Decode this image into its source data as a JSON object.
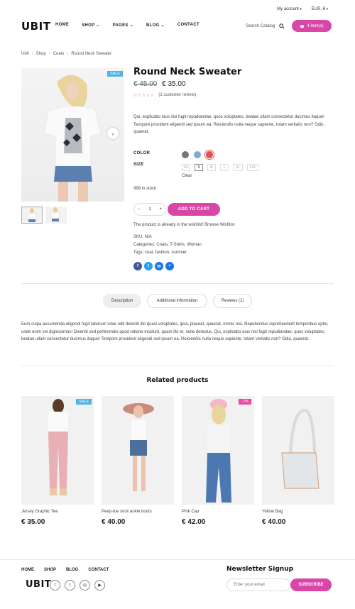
{
  "topbar": {
    "account": "My account",
    "currency": "EUR, €"
  },
  "logo": "UBIT",
  "nav": [
    "HOME",
    "SHOP",
    "PAGES",
    "BLOG",
    "CONTACT"
  ],
  "search": {
    "placeholder": "Search Catalog"
  },
  "cart": {
    "label": "4 item(s)"
  },
  "breadcrumb": [
    "Ubit",
    "Shop",
    "Coats",
    "Round Neck Sweater"
  ],
  "product": {
    "badge": "SALE",
    "title": "Round Neck Sweater",
    "old_price": "€ 45.00",
    "price": "€ 35.00",
    "stars": "☆☆☆☆☆",
    "review": "(1 customer review)",
    "description": "Qui, explicabo eius nisi fugit repudiandae, quos voluptates, beatae ullam consectetur ducimus itaque! Tempore provident eligendi sed ipsum ea. Reiciendis nulla neque sapiente, totam veritatis non? Odio, quaerat.",
    "color_label": "COLOR",
    "colors": [
      "#777777",
      "#7fa9d6",
      "#e35050"
    ],
    "size_label": "SIZE",
    "sizes": [
      "XS",
      "S",
      "M",
      "L",
      "XL",
      "XXL"
    ],
    "selected_size": "S",
    "clear": "Clear",
    "stock": "999 in stock",
    "qty": "1",
    "add_to_cart": "ADD TO CART",
    "wishlist": "The product is already in the wishlist! Browse Wishlist",
    "sku": "SKU: N/A",
    "categories": "Categories: Coats, T-Shirts, Woman",
    "tags": "Tags: coat, fashion, summer",
    "share_colors": [
      "#3b5998",
      "#1da1f2",
      "#1a73e8",
      "#1a73e8"
    ]
  },
  "tabs": [
    "Description",
    "Additional information",
    "Reviews (1)"
  ],
  "long_description": "Eum culpa assumenda eligendi fugit laborum vitae odit deleniti illo quasi voluptates, ipsa, placeat, quaerat, omnis nisi. Repellendus reprehenderit temporibus optio, unde enim vel dignissimos! Deleniti sed perferendis quod ratione incidunt, quam illo et, nulla delectus. Qui, explicabo eius nisi fugit repudiandae, quos voluptates, beatae ullam consectetur ducimus itaque! Tempore provident eligendi sed ipsum ea. Reiciendis nulla neque sapiente, totam veritatis non? Odio, quaerat.",
  "related": {
    "title": "Related products",
    "items": [
      {
        "name": "Jersey Graphic Tee",
        "price": "€ 35.00",
        "badge": "SALE"
      },
      {
        "name": "Peep-toe sock ankle boots",
        "price": "€ 40.00",
        "badge": ""
      },
      {
        "name": "Pink Cap",
        "price": "€ 42.00",
        "badge": "-7%"
      },
      {
        "name": "Yellow Bag",
        "price": "€ 40.00",
        "badge": ""
      }
    ]
  },
  "footer": {
    "nav": [
      "HOME",
      "SHOP",
      "BLOG",
      "CONTACT"
    ],
    "logo": "UBIT",
    "newsletter_title": "Newsletter Signup",
    "email_placeholder": "Enter your email",
    "subscribe": "SUBSCRIBE"
  }
}
